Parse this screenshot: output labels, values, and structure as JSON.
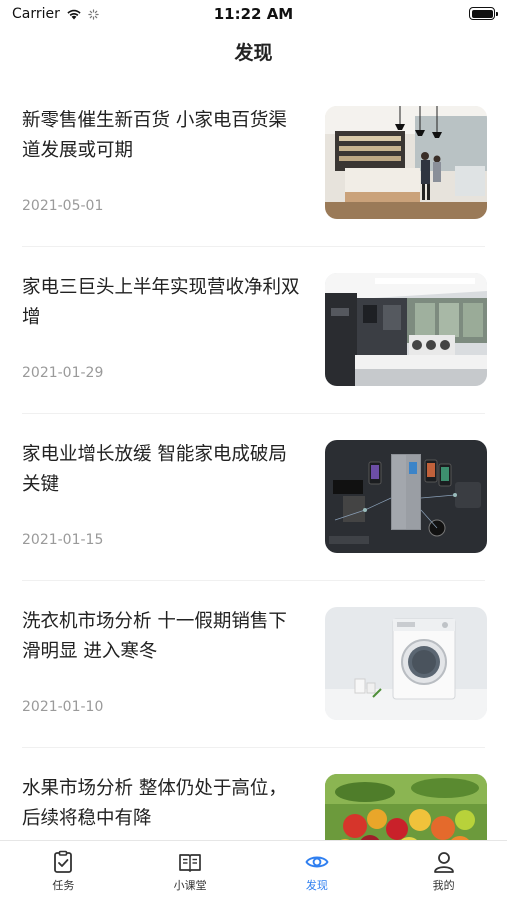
{
  "status_bar": {
    "carrier": "Carrier",
    "time": "11:22 AM"
  },
  "nav": {
    "title": "发现"
  },
  "articles": [
    {
      "title": "新零售催生新百货 小家电百货渠道发展或可期",
      "date": "2021-05-01",
      "image": "appliance-store-photo"
    },
    {
      "title": "家电三巨头上半年实现营收净利双增",
      "date": "2021-01-29",
      "image": "kitchen-showroom-photo"
    },
    {
      "title": "家电业增长放缓 智能家电成破局关键",
      "date": "2021-01-15",
      "image": "smart-appliances-photo"
    },
    {
      "title": "洗衣机市场分析 十一假期销售下滑明显 进入寒冬",
      "date": "2021-01-10",
      "image": "washing-machine-photo"
    },
    {
      "title": "水果市场分析 整体仍处于高位，后续将稳中有降",
      "date": "",
      "image": "fruit-photo"
    }
  ],
  "tabbar": {
    "active_color": "#2f7ff0",
    "tabs": [
      {
        "label": "任务",
        "icon": "task-icon"
      },
      {
        "label": "小课堂",
        "icon": "book-icon"
      },
      {
        "label": "发现",
        "icon": "eye-icon",
        "active": true
      },
      {
        "label": "我的",
        "icon": "user-icon"
      }
    ]
  }
}
